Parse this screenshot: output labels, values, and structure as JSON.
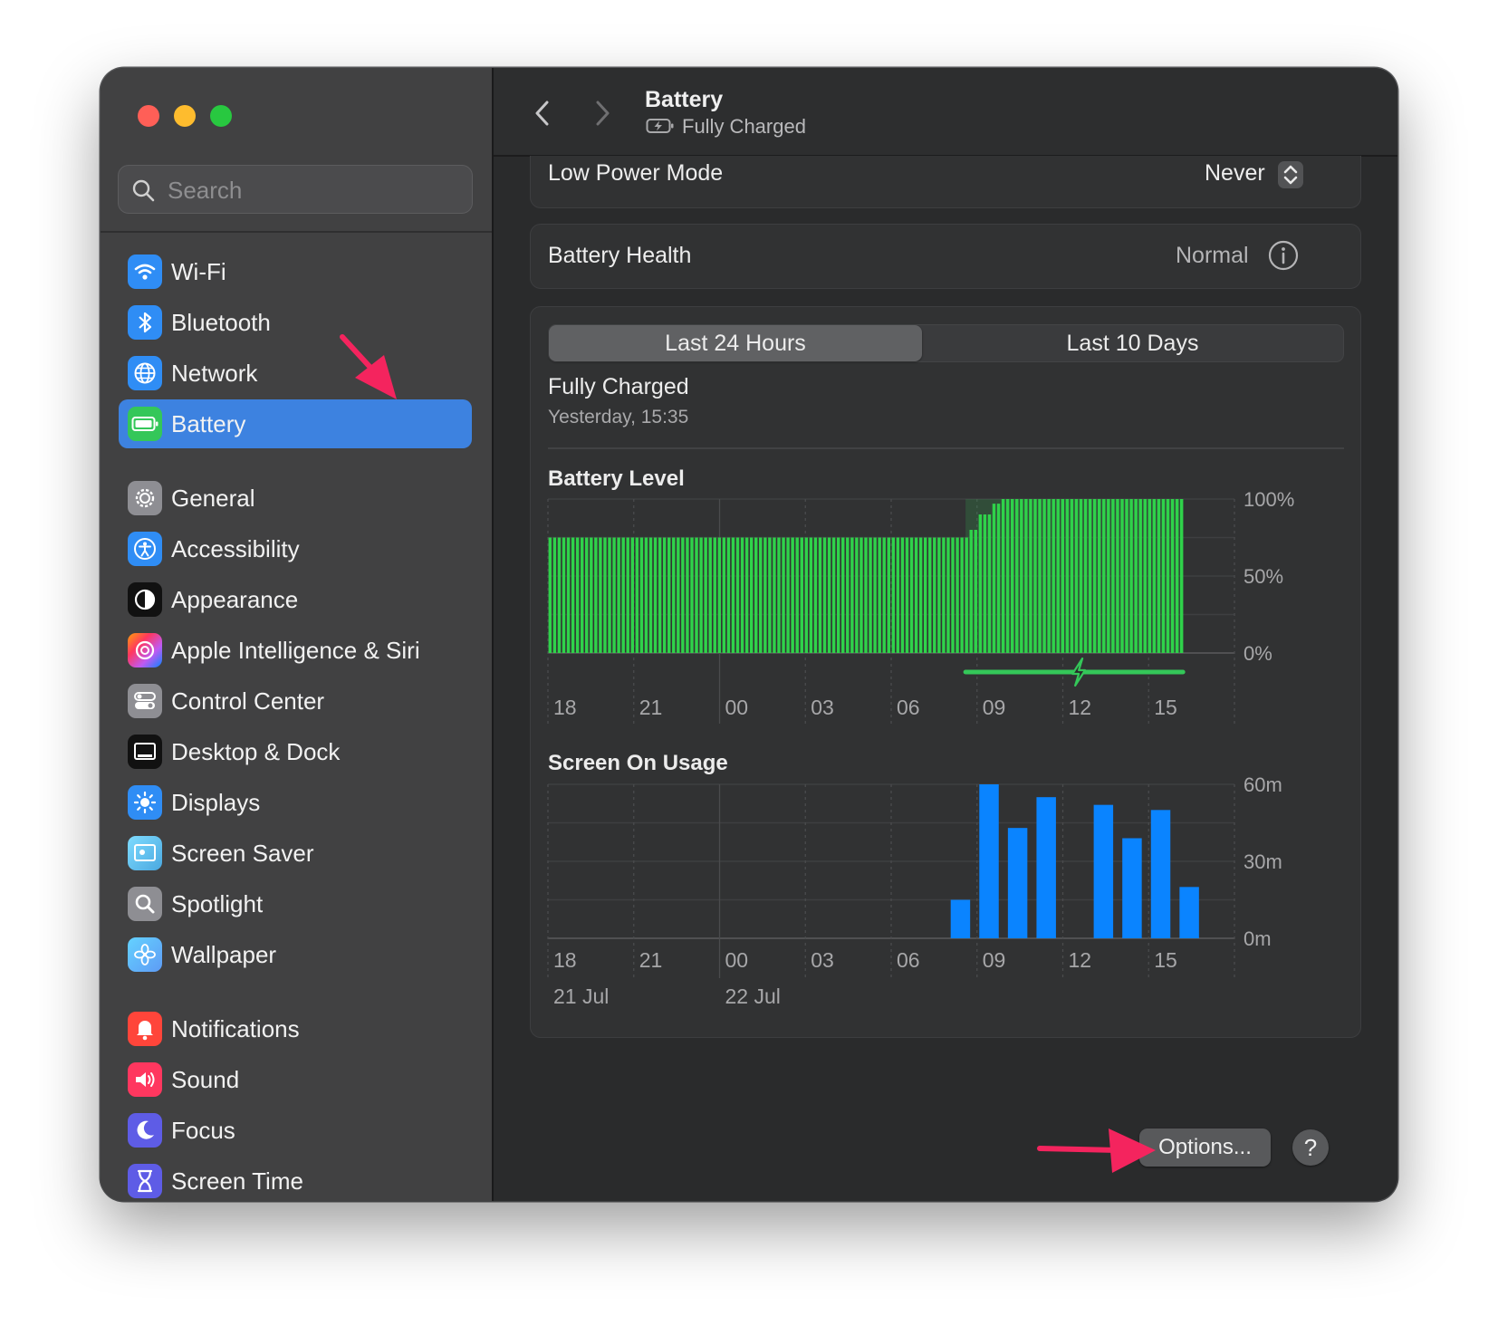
{
  "window": {
    "controls": [
      "close",
      "minimize",
      "zoom"
    ]
  },
  "sidebar": {
    "search_placeholder": "Search",
    "items": [
      {
        "label": "Wi-Fi",
        "icon": "wifi-icon",
        "color": "#2f8df5",
        "selected": false
      },
      {
        "label": "Bluetooth",
        "icon": "bluetooth-icon",
        "color": "#2f8df5",
        "selected": false
      },
      {
        "label": "Network",
        "icon": "globe-icon",
        "color": "#2f8df5",
        "selected": false
      },
      {
        "label": "Battery",
        "icon": "battery-icon",
        "color": "#34c759",
        "selected": true
      },
      {
        "label": "General",
        "icon": "gear-icon",
        "color": "#8e8e93",
        "selected": false
      },
      {
        "label": "Accessibility",
        "icon": "accessibility-icon",
        "color": "#2f8df5",
        "selected": false
      },
      {
        "label": "Appearance",
        "icon": "appearance-icon",
        "color": "#111111",
        "selected": false
      },
      {
        "label": "Apple Intelligence & Siri",
        "icon": "siri-icon",
        "color": "#f0568c",
        "selected": false
      },
      {
        "label": "Control Center",
        "icon": "control-center-icon",
        "color": "#8e8e93",
        "selected": false
      },
      {
        "label": "Desktop & Dock",
        "icon": "desktop-dock-icon",
        "color": "#111111",
        "selected": false
      },
      {
        "label": "Displays",
        "icon": "sun-icon",
        "color": "#2f8df5",
        "selected": false
      },
      {
        "label": "Screen Saver",
        "icon": "screen-saver-icon",
        "color": "#5ac8fa",
        "selected": false
      },
      {
        "label": "Spotlight",
        "icon": "magnifier-icon",
        "color": "#8e8e93",
        "selected": false
      },
      {
        "label": "Wallpaper",
        "icon": "wallpaper-icon",
        "color": "#5ac8fa",
        "selected": false
      },
      {
        "label": "Notifications",
        "icon": "bell-icon",
        "color": "#ff453a",
        "selected": false
      },
      {
        "label": "Sound",
        "icon": "speaker-icon",
        "color": "#ff375f",
        "selected": false
      },
      {
        "label": "Focus",
        "icon": "moon-icon",
        "color": "#5e5ce6",
        "selected": false
      },
      {
        "label": "Screen Time",
        "icon": "hourglass-icon",
        "color": "#5e5ce6",
        "selected": false
      }
    ]
  },
  "toolbar": {
    "title": "Battery",
    "subtitle": "Fully Charged"
  },
  "settings": {
    "low_power_label": "Low Power Mode",
    "low_power_value": "Never",
    "health_label": "Battery Health",
    "health_value": "Normal"
  },
  "history": {
    "tabs": [
      {
        "label": "Last 24 Hours",
        "active": true
      },
      {
        "label": "Last 10 Days",
        "active": false
      }
    ],
    "status_title": "Fully Charged",
    "status_time": "Yesterday, 15:35"
  },
  "chart_data": [
    {
      "type": "bar",
      "title": "Battery Level",
      "y_unit": "%",
      "ylim": [
        0,
        100
      ],
      "y_ticks": [
        "100%",
        "50%",
        "0%"
      ],
      "x_ticks": [
        "18",
        "21",
        "00",
        "03",
        "06",
        "09",
        "12",
        "15"
      ],
      "grid": true,
      "bar_color": "#2fd24a",
      "charging_color": "#34c759",
      "segments": [
        {
          "from_hour": 0,
          "to_hour": 14.6,
          "level": 75
        },
        {
          "from_hour": 14.6,
          "to_hour": 15.0,
          "level": 80
        },
        {
          "from_hour": 15.0,
          "to_hour": 15.4,
          "level": 90
        },
        {
          "from_hour": 15.4,
          "to_hour": 15.8,
          "level": 97
        },
        {
          "from_hour": 15.8,
          "to_hour": 22.2,
          "level": 100
        }
      ],
      "charging_range_hours": [
        14.6,
        22.2
      ]
    },
    {
      "type": "bar",
      "title": "Screen On Usage",
      "y_unit": "m",
      "ylim": [
        0,
        60
      ],
      "y_ticks": [
        "60m",
        "30m",
        "0m"
      ],
      "x_ticks": [
        "18",
        "21",
        "00",
        "03",
        "06",
        "09",
        "12",
        "15"
      ],
      "date_labels": [
        "21 Jul",
        "22 Jul"
      ],
      "grid": true,
      "bar_color": "#0a84ff",
      "bars": [
        {
          "hour": 14,
          "minutes": 15
        },
        {
          "hour": 15,
          "minutes": 60
        },
        {
          "hour": 16,
          "minutes": 43
        },
        {
          "hour": 17,
          "minutes": 55
        },
        {
          "hour": 19,
          "minutes": 52
        },
        {
          "hour": 20,
          "minutes": 39
        },
        {
          "hour": 21,
          "minutes": 50
        },
        {
          "hour": 22,
          "minutes": 20
        }
      ]
    }
  ],
  "footer": {
    "options_label": "Options...",
    "help_label": "?"
  },
  "annotation_color": "#f4245e"
}
